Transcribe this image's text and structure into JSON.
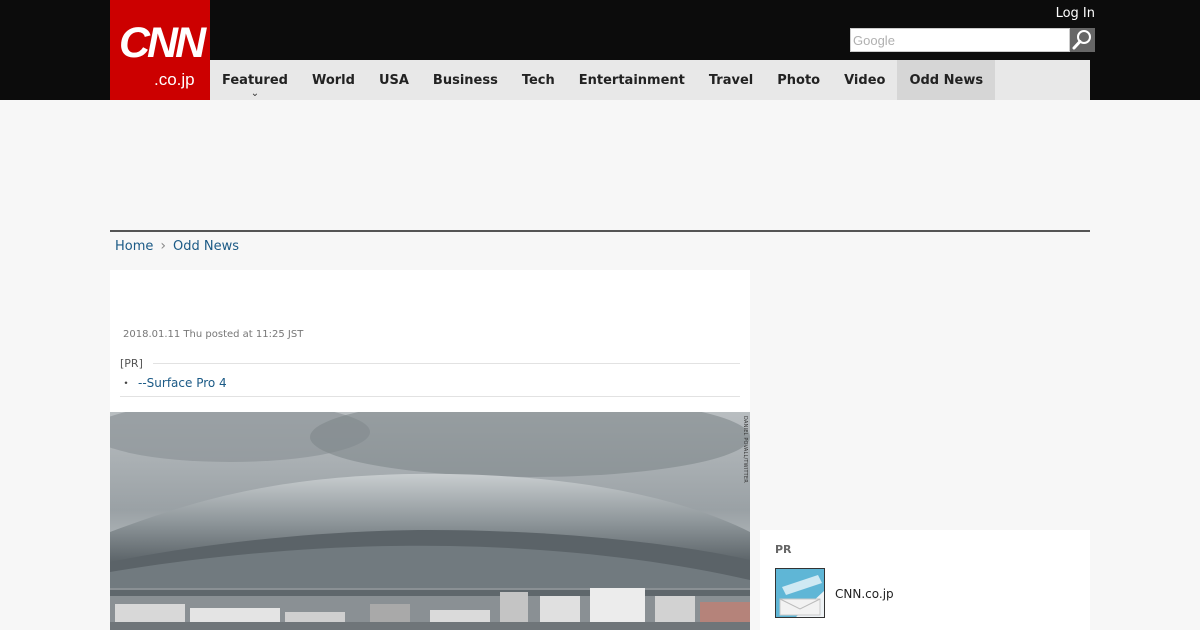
{
  "header": {
    "logo_text": "CNN",
    "logo_domain": ".co.jp",
    "login_label": "Log In",
    "search_placeholder": "Google"
  },
  "nav": {
    "items": [
      {
        "label": "Featured"
      },
      {
        "label": "World"
      },
      {
        "label": "USA"
      },
      {
        "label": "Business"
      },
      {
        "label": "Tech"
      },
      {
        "label": "Entertainment"
      },
      {
        "label": "Travel"
      },
      {
        "label": "Photo"
      },
      {
        "label": "Video"
      },
      {
        "label": "Odd News"
      }
    ],
    "active": "Odd News"
  },
  "breadcrumb": {
    "home": "Home",
    "current": "Odd News"
  },
  "article": {
    "posted": "2018.01.11 Thu posted at 11:25 JST",
    "pr_label": "[PR]",
    "pr_link_bullet": "・",
    "pr_link": "--Surface Pro 4",
    "photo_credit": "DANIEL POVALL/TWITTER"
  },
  "sidebar": {
    "pr_label": "PR",
    "pr_item_name": "CNN.co.jp"
  },
  "colors": {
    "brand_red": "#cc0000",
    "topbar": "#0c0c0c",
    "link": "#1b5a86"
  }
}
